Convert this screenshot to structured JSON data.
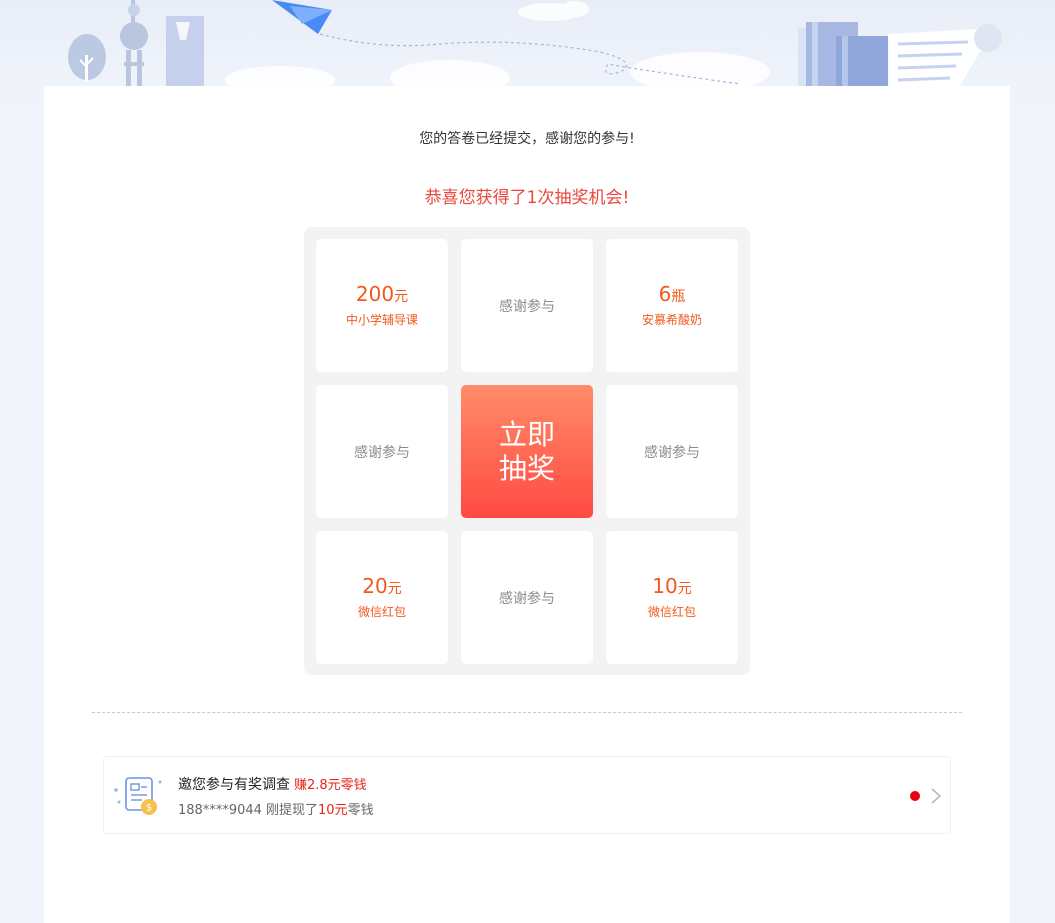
{
  "message": {
    "thanks": "您的答卷已经提交，感谢您的参与!",
    "congrats": "恭喜您获得了1次抽奖机会!"
  },
  "lottery": {
    "cells": [
      {
        "type": "prize",
        "amount": "200",
        "unit": "元",
        "desc": "中小学辅导课"
      },
      {
        "type": "thanks",
        "label": "感谢参与"
      },
      {
        "type": "prize",
        "amount": "6",
        "unit": "瓶",
        "desc": "安慕希酸奶"
      },
      {
        "type": "thanks",
        "label": "感谢参与"
      },
      {
        "type": "button",
        "label": "立即抽奖",
        "line1": "立即",
        "line2": "抽奖"
      },
      {
        "type": "thanks",
        "label": "感谢参与"
      },
      {
        "type": "prize",
        "amount": "20",
        "unit": "元",
        "desc": "微信红包"
      },
      {
        "type": "thanks",
        "label": "感谢参与"
      },
      {
        "type": "prize",
        "amount": "10",
        "unit": "元",
        "desc": "微信红包"
      }
    ]
  },
  "invite": {
    "title": "邀您参与有奖调查",
    "earn": "赚2.8元零钱",
    "sub_prefix": "188****9044 刚提现了",
    "sub_amount": "10元",
    "sub_suffix": "零钱"
  },
  "icons": {
    "survey": "survey-money-icon",
    "chevron": "chevron-right-icon",
    "notification": "red-dot-badge"
  },
  "colors": {
    "accent": "#e8483d",
    "prize": "#f05a1c",
    "button_top": "#ff8c68",
    "button_bottom": "#ff4a43",
    "background": "#f1f4fa"
  }
}
